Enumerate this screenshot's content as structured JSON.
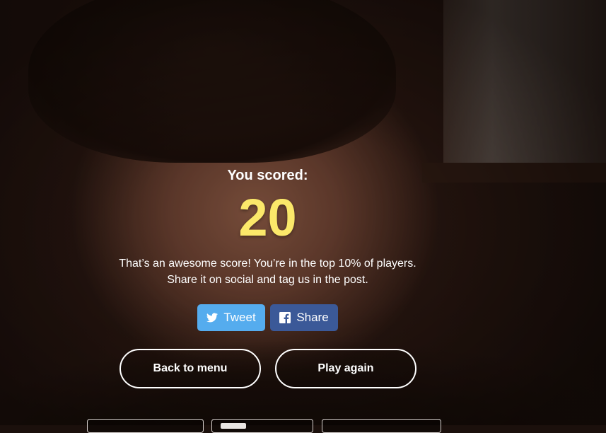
{
  "result": {
    "label": "You scored:",
    "score": "20",
    "message_line1": "That’s an awesome score! You’re in the top 10% of players.",
    "message_line2": "Share it on social and tag us in the post."
  },
  "share": {
    "tweet_label": "Tweet",
    "tweet_icon": "twitter-bird-icon",
    "facebook_label": "Share",
    "facebook_icon": "facebook-icon",
    "tweet_color": "#55acee",
    "facebook_color": "#3b5998"
  },
  "actions": {
    "back_label": "Back to menu",
    "play_again_label": "Play again"
  },
  "colors": {
    "score_color": "#fbe86a",
    "text_color": "#ffffff"
  }
}
